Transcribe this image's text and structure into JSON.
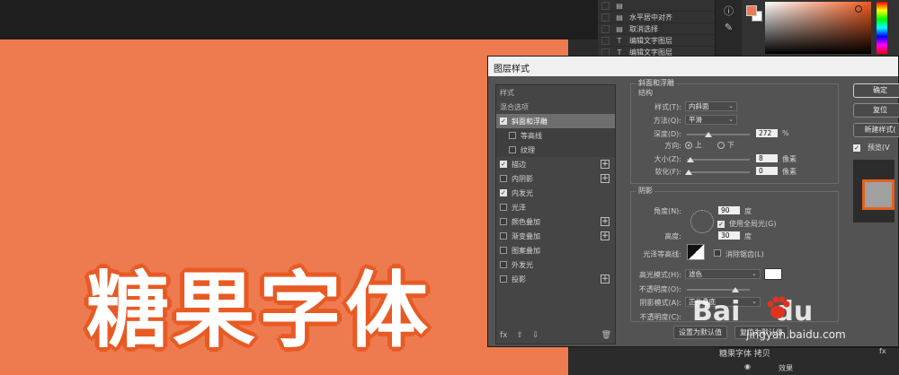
{
  "canvas": {
    "title": "糖果字体",
    "bg_color": "#ed7b4f",
    "stroke_color": "#e85a24"
  },
  "history": {
    "items": [
      {
        "label": "",
        "icon": "doc-icon"
      },
      {
        "label": "水平居中对齐",
        "icon": "doc-icon"
      },
      {
        "label": "取消选择",
        "icon": "doc-icon"
      },
      {
        "label": "编辑文字图层",
        "icon": "text-tool-icon"
      },
      {
        "label": "编辑文字图层",
        "icon": "text-tool-icon"
      }
    ]
  },
  "color": {
    "foreground": "#ed7b4f",
    "background": "#ffffff"
  },
  "dialog": {
    "title": "图层样式",
    "left": {
      "head1": "样式",
      "head2": "混合选项",
      "items": [
        {
          "label": "斜面和浮雕",
          "checked": true,
          "selected": true,
          "sub": false,
          "plus": false
        },
        {
          "label": "等高线",
          "checked": false,
          "selected": false,
          "sub": true,
          "plus": false
        },
        {
          "label": "纹理",
          "checked": false,
          "selected": false,
          "sub": true,
          "plus": false
        },
        {
          "label": "描边",
          "checked": true,
          "selected": false,
          "sub": false,
          "plus": true
        },
        {
          "label": "内阴影",
          "checked": false,
          "selected": false,
          "sub": false,
          "plus": true
        },
        {
          "label": "内发光",
          "checked": true,
          "selected": false,
          "sub": false,
          "plus": false
        },
        {
          "label": "光泽",
          "checked": false,
          "selected": false,
          "sub": false,
          "plus": false
        },
        {
          "label": "颜色叠加",
          "checked": false,
          "selected": false,
          "sub": false,
          "plus": true
        },
        {
          "label": "渐变叠加",
          "checked": false,
          "selected": false,
          "sub": false,
          "plus": true
        },
        {
          "label": "图案叠加",
          "checked": false,
          "selected": false,
          "sub": false,
          "plus": false
        },
        {
          "label": "外发光",
          "checked": false,
          "selected": false,
          "sub": false,
          "plus": false
        },
        {
          "label": "投影",
          "checked": false,
          "selected": false,
          "sub": false,
          "plus": true
        }
      ],
      "footer_fx": "fx"
    },
    "bevel": {
      "group_title": "斜面和浮雕",
      "struct_title": "结构",
      "style_label": "样式(T):",
      "style_value": "内斜面",
      "method_label": "方法(Q):",
      "method_value": "平滑",
      "depth_label": "深度(D):",
      "depth_value": "272",
      "depth_unit": "%",
      "direction_label": "方向:",
      "dir_up": "上",
      "dir_down": "下",
      "size_label": "大小(Z):",
      "size_value": "8",
      "size_unit": "像素",
      "soften_label": "软化(F):",
      "soften_value": "0",
      "soften_unit": "像素"
    },
    "shading": {
      "title": "阴影",
      "angle_label": "角度(N):",
      "angle_value": "90",
      "angle_unit": "度",
      "global_light": "使用全局光(G)",
      "altitude_label": "高度:",
      "altitude_value": "30",
      "altitude_unit": "度",
      "gloss_label": "光泽等高线:",
      "antialias": "消除锯齿(L)",
      "highlight_label": "高光模式(H):",
      "highlight_value": "滤色",
      "opacity1_label": "不透明度(O):",
      "shadow_label": "阴影模式(A):",
      "shadow_value": "正片叠底",
      "opacity2_label": "不透明度(C):"
    },
    "buttons": {
      "make_default": "设置为默认值",
      "reset_default": "复位为默认值"
    },
    "right": {
      "ok": "确定",
      "reset": "复位",
      "new_style": "新建样式(",
      "preview": "预览(V"
    }
  },
  "layers": {
    "layer_name": "糖果字体 拷贝",
    "effects": "效果",
    "fx": "fx"
  },
  "watermark": {
    "logo_a": "Bai",
    "logo_b": "du",
    "url": "jingyan.baidu.com"
  }
}
